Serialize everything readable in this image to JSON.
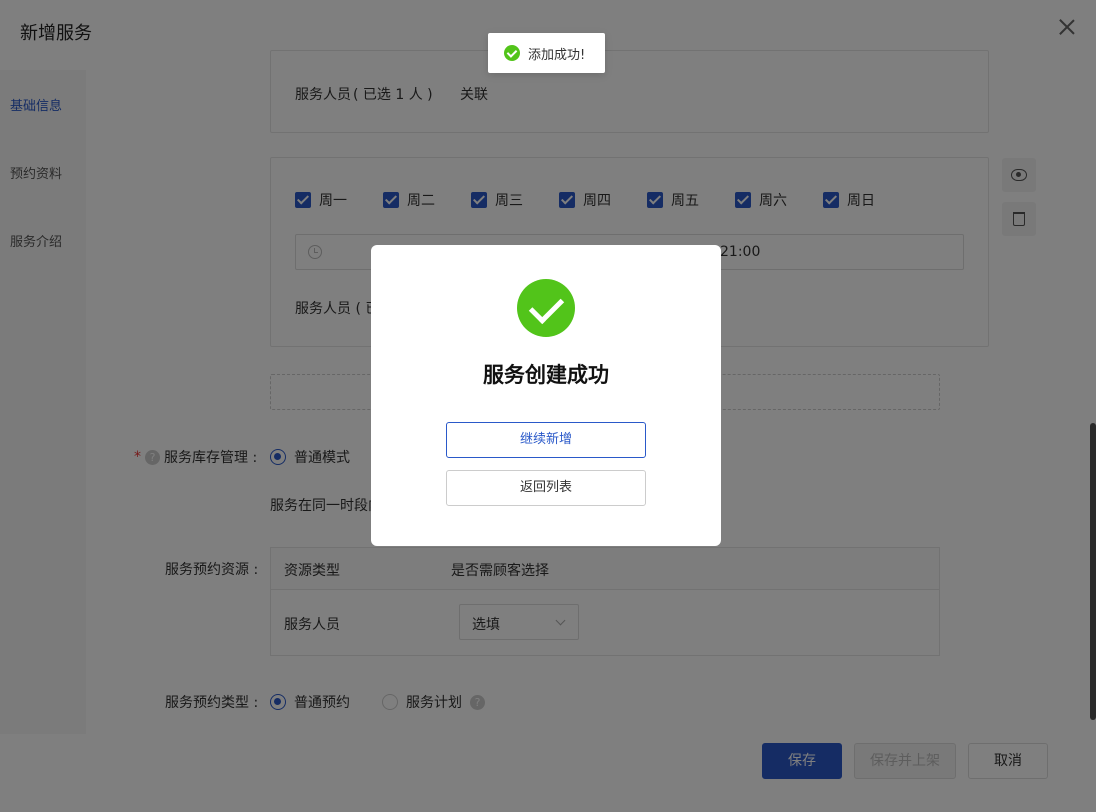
{
  "header": {
    "title": "新增服务"
  },
  "side_nav": {
    "items": [
      {
        "label": "基础信息",
        "active": true
      },
      {
        "label": "预约资料",
        "active": false
      },
      {
        "label": "服务介绍",
        "active": false
      }
    ]
  },
  "card1": {
    "staff_label": "服务人员",
    "staff_count": "( 已选 1 人 )",
    "link": "关联"
  },
  "card2": {
    "days": [
      "周一",
      "周二",
      "周三",
      "周四",
      "周五",
      "周六",
      "周日"
    ],
    "time_end": "21:00",
    "staff_label": "服务人员 ( 已"
  },
  "inventory": {
    "required_mark": "*",
    "help": "?",
    "label": "服务库存管理 :",
    "mode": "普通模式",
    "desc": "服务在同一时段内"
  },
  "resource": {
    "label": "服务预约资源 :",
    "columns": [
      "资源类型",
      "是否需顾客选择"
    ],
    "row_type": "服务人员",
    "select_value": "选填"
  },
  "booking_type": {
    "label": "服务预约类型 :",
    "opt1": "普通预约",
    "opt2": "服务计划",
    "help": "?"
  },
  "footer": {
    "save": "保存",
    "save_publish": "保存并上架",
    "cancel": "取消"
  },
  "toast": {
    "text": "添加成功!"
  },
  "modal": {
    "title": "服务创建成功",
    "continue": "继续新增",
    "back": "返回列表"
  },
  "colors": {
    "primary": "#2a59c9",
    "success": "#52c41a"
  }
}
